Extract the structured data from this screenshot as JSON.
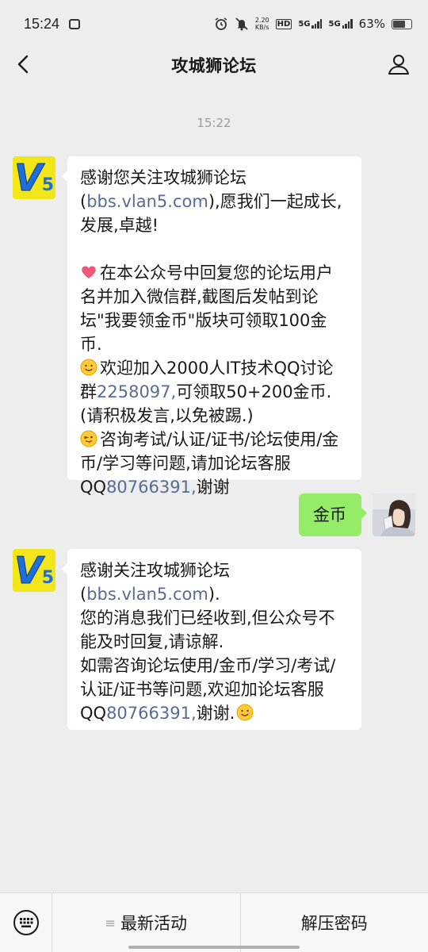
{
  "status_bar": {
    "time": "15:24",
    "net_speed": "2.20",
    "net_unit": "KB/s",
    "hd_label": "HD",
    "sim1": "5G",
    "sim2": "5G",
    "battery": "63%"
  },
  "nav": {
    "title": "攻城狮论坛",
    "back_icon": "chevron-left-icon",
    "profile_icon": "person-icon"
  },
  "chat": {
    "timestamp": "15:22",
    "messages": [
      {
        "from": "bot",
        "avatar_text_v": "V",
        "avatar_text_5": "5",
        "line1_pre": "感谢您关注攻城狮论坛(",
        "line1_link": "bbs.vlan5.",
        "line2_link": "com",
        "line2_post": "),愿我们一起成长,发展,卓越!",
        "para1": "在本公众号中回复您的论坛用户名并加入微信群,截图后发帖到论坛\"我要领金币\"版块可领取100金币.",
        "para2_pre": "欢迎加入2000人IT技术QQ讨论群",
        "para2_link": "2258097,",
        "para2_post": "可领取50+200金币.(请积极发言,以免被踢.)",
        "para3_pre": "咨询考试/认证/证书/论坛使用/金币/学习等问题,请加论坛客服QQ",
        "para3_link": "80766391,",
        "para3_post": "谢谢"
      },
      {
        "from": "me",
        "text": "金币"
      },
      {
        "from": "bot",
        "line1_pre": "感谢关注攻城狮论坛(",
        "line1_link": "bbs.vlan5.",
        "line2_link": "com",
        "line2_post": ").",
        "para1": "您的消息我们已经收到,但公众号不能及时回复,请谅解.",
        "para2_pre": "如需咨询论坛使用/金币/学习/考试/认证/证书等问题,欢迎加论坛客服QQ",
        "para2_link": "80766391,",
        "para2_post": "谢谢."
      }
    ]
  },
  "bottom_menu": {
    "keyboard_icon": "keyboard-icon",
    "item1_glyph": "≡",
    "item1": "最新活动",
    "item2": "解压密码"
  },
  "colors": {
    "background": "#ededed",
    "bubble_me": "#95ec69",
    "link": "#576b95",
    "avatar_bg": "#f1e619"
  }
}
